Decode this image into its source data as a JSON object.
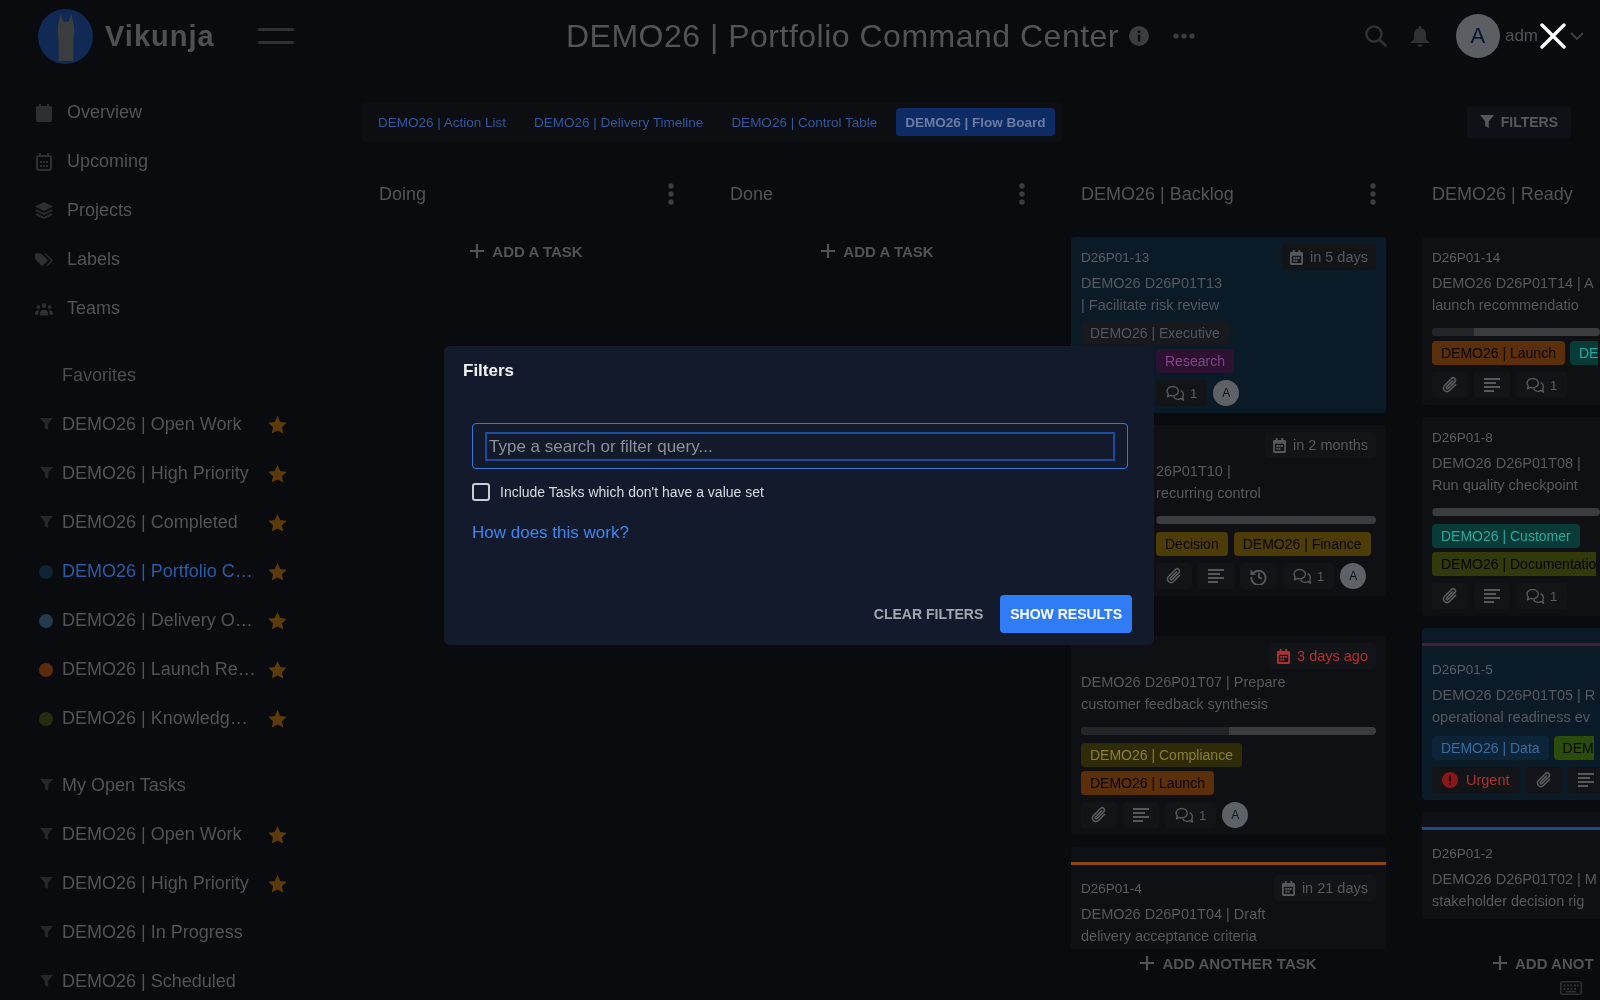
{
  "header": {
    "brand": "Vikunja",
    "title": "DEMO26 | Portfolio Command Center",
    "avatar_initial": "A",
    "username": "adm"
  },
  "sidebar": {
    "nav": [
      "Overview",
      "Upcoming",
      "Projects",
      "Labels",
      "Teams"
    ],
    "sections": [
      {
        "title": "Favorites",
        "items": [
          {
            "label": "DEMO26 | Open Work",
            "kind": "filter",
            "favorite": true,
            "selected": false
          },
          {
            "label": "DEMO26 | High Priority",
            "kind": "filter",
            "favorite": true,
            "selected": false
          },
          {
            "label": "DEMO26 | Completed",
            "kind": "filter",
            "favorite": true,
            "selected": false
          },
          {
            "label": "DEMO26 | Portfolio C…",
            "kind": "project",
            "color": "#0d2433",
            "favorite": true,
            "selected": true
          },
          {
            "label": "DEMO26 | Delivery O…",
            "kind": "project",
            "color": "#243b4f",
            "favorite": true,
            "selected": false
          },
          {
            "label": "DEMO26 | Launch Re…",
            "kind": "project",
            "color": "#5a2c0c",
            "favorite": true,
            "selected": false
          },
          {
            "label": "DEMO26 | Knowledg…",
            "kind": "project",
            "color": "#272c0f",
            "favorite": true,
            "selected": false
          }
        ]
      },
      {
        "items": [
          {
            "label": "My Open Tasks",
            "kind": "filter",
            "favorite": false,
            "selected": false
          },
          {
            "label": "DEMO26 | Open Work",
            "kind": "filter",
            "favorite": true,
            "selected": false
          },
          {
            "label": "DEMO26 | High Priority",
            "kind": "filter",
            "favorite": true,
            "selected": false
          },
          {
            "label": "DEMO26 | In Progress",
            "kind": "filter",
            "favorite": false,
            "selected": false
          },
          {
            "label": "DEMO26 | Scheduled",
            "kind": "filter",
            "favorite": false,
            "selected": false
          }
        ]
      }
    ]
  },
  "views": [
    {
      "label": "DEMO26 | Action List",
      "selected": false
    },
    {
      "label": "DEMO26 | Delivery Timeline",
      "selected": false
    },
    {
      "label": "DEMO26 | Control Table",
      "selected": false
    },
    {
      "label": "DEMO26 | Flow Board",
      "selected": true
    }
  ],
  "filters_button": "FILTERS",
  "columns": [
    {
      "title": "Doing",
      "menu": true,
      "add_label": "ADD A TASK"
    },
    {
      "title": "Done",
      "menu": true,
      "add_label": "ADD A TASK"
    },
    {
      "title": "DEMO26 | Backlog",
      "menu": true,
      "add_label": "ADD ANOTHER TASK",
      "cards": [
        {
          "id": "D26P01-13",
          "due": {
            "text": "in 5 days",
            "overdue": false
          },
          "title": "DEMO26 D26P01T13\n| Facilitate risk review",
          "tinted": true,
          "labels": [
            {
              "text": "DEMO26 | Executive",
              "color": "#17191d"
            },
            {
              "text": "Research",
              "color": "#2d1130"
            }
          ],
          "footer": [
            {
              "kind": "comments",
              "count": "1"
            },
            {
              "kind": "assignee",
              "initial": "A"
            }
          ]
        },
        {
          "due": {
            "text": "in 2 months",
            "overdue": false
          },
          "title": "26P01T10 |\nrecurring control",
          "tinted": false,
          "level": 0,
          "labels": [
            {
              "text": "Decision",
              "color": "#4d3c06"
            },
            {
              "text": "DEMO26 | Finance",
              "color": "#4d3c06"
            }
          ],
          "footer": [
            {
              "kind": "attachment"
            },
            {
              "kind": "description"
            },
            {
              "kind": "history"
            },
            {
              "kind": "comments",
              "count": "1"
            },
            {
              "kind": "assignee",
              "initial": "A"
            }
          ]
        },
        {
          "due": {
            "text": "3 days ago",
            "overdue": true
          },
          "title": "DEMO26 D26P01T07 | Prepare\ncustomer feedback synthesis",
          "tinted": false,
          "level": 0.5,
          "labels": [
            {
              "text": "DEMO26 | Compliance",
              "color": "#2f2b06"
            },
            {
              "text": "DEMO26 | Launch",
              "color": "#5c2f0b"
            }
          ],
          "footer": [
            {
              "kind": "attachment"
            },
            {
              "kind": "description"
            },
            {
              "kind": "comments",
              "count": "1"
            },
            {
              "kind": "assignee",
              "initial": "A"
            }
          ]
        },
        {
          "id": "D26P01-4",
          "due": {
            "text": "in 21 days",
            "overdue": false
          },
          "title": "DEMO26 D26P01T04 | Draft\ndelivery acceptance criteria",
          "tinted": false,
          "color": "#8a4510"
        }
      ]
    },
    {
      "title": "DEMO26 | Ready",
      "menu": false,
      "add_label": "ADD ANOT",
      "cards": [
        {
          "id": "D26P01-14",
          "title": "DEMO26 D26P01T14 | A\nlaunch recommendatio",
          "tinted": false,
          "level": 0.25,
          "labels": [
            {
              "text": "DEMO26 | Launch",
              "color": "#5c2f0b"
            },
            {
              "text": "DE",
              "color": "#083b37"
            }
          ],
          "footer": [
            {
              "kind": "attachment"
            },
            {
              "kind": "description"
            },
            {
              "kind": "comments",
              "count": "1"
            }
          ]
        },
        {
          "id": "D26P01-8",
          "title": "DEMO26 D26P01T08 |\nRun quality checkpoint",
          "tinted": false,
          "level": 0,
          "labels": [
            {
              "text": "DEMO26 | Customer",
              "color": "#083b37"
            },
            {
              "text": "DEMO26 | Documentatio",
              "color": "#32390a"
            }
          ],
          "footer": [
            {
              "kind": "attachment"
            },
            {
              "kind": "description"
            },
            {
              "kind": "comments",
              "count": "1"
            }
          ]
        },
        {
          "id": "D26P01-5",
          "title": "DEMO26 D26P01T05 | R\noperational readiness ev",
          "tinted": true,
          "color": "#4a1f33",
          "labels": [
            {
              "text": "DEMO26 | Data",
              "color": "#0c2338"
            },
            {
              "text": "DEM",
              "color": "#2c4c0b"
            }
          ],
          "footer": [
            {
              "kind": "priority",
              "text": "Urgent"
            },
            {
              "kind": "attachment"
            },
            {
              "kind": "description"
            }
          ]
        },
        {
          "id": "D26P01-2",
          "title": "DEMO26 D26P01T02 | M\nstakeholder decision rig",
          "tinted": false,
          "color": "#1d4a8a"
        }
      ]
    }
  ],
  "dialog": {
    "title": "Filters",
    "placeholder": "Type a search or filter query...",
    "option": {
      "label": "Include Tasks which don't have a value set",
      "checked": false
    },
    "help_link": "How does this work?",
    "buttons": [
      {
        "label": "CLEAR FILTERS",
        "kind": "secondary"
      },
      {
        "label": "SHOW RESULTS",
        "kind": "primary"
      }
    ]
  }
}
